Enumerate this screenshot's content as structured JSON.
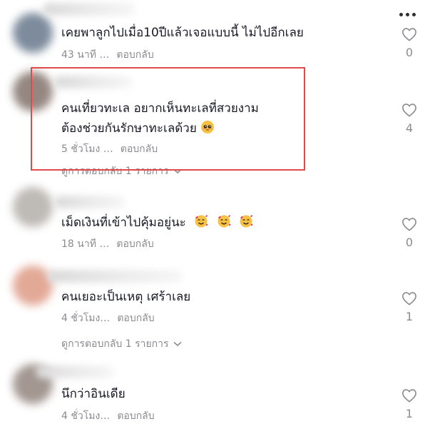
{
  "comments": [
    {
      "text": "เคยพาลูกไปเมื่อ10ปีแล้วเจอแบบนี้ ไม่ไปอีกเลย",
      "time": "43 นาที …",
      "reply": "ตอบกลับ",
      "likes": "0"
    },
    {
      "text_line1": "คนเที่ยวทะเล อยากเห็นทะเลที่สวยงาม",
      "text_line2": "ต้องช่วยกันรักษาทะเลด้วย",
      "emoji": "pleading-face",
      "time": "5 ชั่วโมง …",
      "reply": "ตอบกลับ",
      "likes": "4",
      "view_replies": "ดูการตอบกลับ 1 รายการ"
    },
    {
      "text": "เม็ดเงินที่เข้าไปคุ้มอยู่นะ",
      "emojis": [
        "smiling-face-with-hearts",
        "smiling-face-with-hearts",
        "smiling-face-with-hearts"
      ],
      "time": "18 นาที …",
      "reply": "ตอบกลับ",
      "likes": "0"
    },
    {
      "text": "คนเยอะเป็นเหตุ เศร้าเลย",
      "time": "4 ชั่วโมง…",
      "reply": "ตอบกลับ",
      "likes": "1",
      "view_replies": "ดูการตอบกลับ 1 รายการ"
    },
    {
      "text": "นึกว่าอินเดีย",
      "time": "4 ชั่วโมง…",
      "reply": "ตอบกลับ",
      "likes": "1"
    }
  ],
  "colors": {
    "highlight": "#e04a4a",
    "meta": "#8a8b91",
    "text": "#161823"
  },
  "icons": {
    "like": "heart-outline-icon",
    "more": "more-horizontal-icon",
    "expand": "chevron-down-icon"
  }
}
